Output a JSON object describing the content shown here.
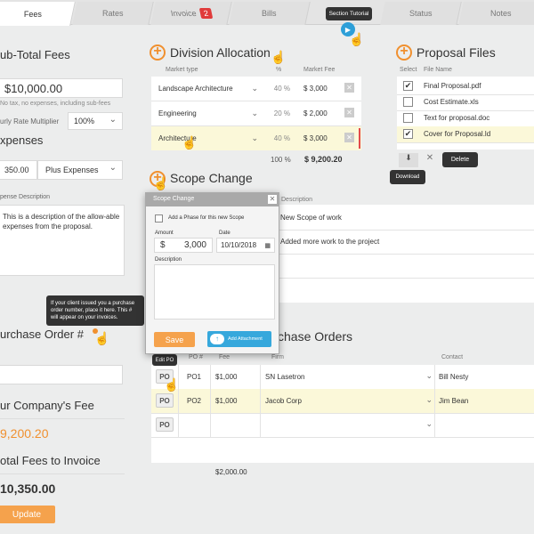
{
  "tabs": [
    {
      "label": "Fees"
    },
    {
      "label": "Rates"
    },
    {
      "label": "Invoice",
      "badge": "2"
    },
    {
      "label": "Bills"
    },
    {
      "label": "Status"
    },
    {
      "label": "Notes"
    }
  ],
  "tutorial": {
    "label": "Section Tutorial"
  },
  "left": {
    "subtotal_title": "ub-Total Fees",
    "subtotal_value": "$10,000.00",
    "subtotal_note": "No tax, no expenses, including sub-fees",
    "multiplier_label": "urly Rate Multiplier",
    "multiplier_value": "100%",
    "expenses_title": "xpenses",
    "expenses_amount": "350.00",
    "expenses_select": "Plus Expenses",
    "expense_desc_label": "pense Description",
    "expense_desc_text": "This is a description of the allow-able expenses from the proposal.",
    "po_tooltip": "If your client issued you a purchase order number, place it here. This # will appear on your invoices.",
    "po_title": "urchase Order #",
    "company_fee_title": "ur Company's Fee",
    "company_fee_value": "9,200.20",
    "total_title": "otal Fees to Invoice",
    "total_value": "10,350.00",
    "update_label": "Update"
  },
  "division": {
    "title": "Division Allocation",
    "headers": {
      "market_type": "Market type",
      "pct": "%",
      "market_fee": "Market Fee"
    },
    "rows": [
      {
        "market": "Landscape Architecture",
        "pct": "40 %",
        "fee": "$ 3,000"
      },
      {
        "market": "Engineering",
        "pct": "20 %",
        "fee": "$ 2,000"
      },
      {
        "market": "Architecture",
        "pct": "40 %",
        "fee": "$ 3,000"
      }
    ],
    "total_pct": "100 %",
    "total_fee": "$ 9,200.20"
  },
  "proposal": {
    "title": "Proposal Files",
    "headers": {
      "select": "Select",
      "file_name": "File Name"
    },
    "files": [
      {
        "name": "Final Proposal.pdf",
        "checked": "✔"
      },
      {
        "name": "Cost Estimate.xls",
        "checked": ""
      },
      {
        "name": "Text for proposal.doc",
        "checked": ""
      },
      {
        "name": "Cover for Proposal.ld",
        "checked": "✔"
      }
    ],
    "delete_label": "Delete",
    "download_label": "Download"
  },
  "scope": {
    "title": "Scope Change",
    "description_header": "Description",
    "rows": [
      {
        "desc": "New Scope of work"
      },
      {
        "desc": "Added more work to the project"
      }
    ]
  },
  "modal": {
    "title": "Scope Change",
    "checkbox_label": "Add a Phase for this new Scope",
    "amount_label": "Amount",
    "amount_currency": "$",
    "amount_value": "3,000",
    "date_label": "Date",
    "date_value": "10/10/2018",
    "description_label": "Description",
    "save_label": "Save",
    "attach_label": "Add Attachment"
  },
  "po": {
    "title": "chase Orders",
    "tooltip": "Edit PO",
    "headers": {
      "po_num": "PO #",
      "fee": "Fee",
      "firm": "Firm",
      "contact": "Contact"
    },
    "rows": [
      {
        "btn": "PO",
        "num": "PO1",
        "fee": "$1,000",
        "firm": "SN Lasetron",
        "contact": "Bill Nesty"
      },
      {
        "btn": "PO",
        "num": "PO2",
        "fee": "$1,000",
        "firm": "Jacob Corp",
        "contact": "Jim Bean"
      },
      {
        "btn": "PO",
        "num": "",
        "fee": "",
        "firm": "",
        "contact": ""
      }
    ],
    "total": "$2,000.00"
  },
  "colors": {
    "accent": "#f0902f",
    "highlight": "#fbf8d9",
    "tutorial": "#2d9fd8"
  }
}
